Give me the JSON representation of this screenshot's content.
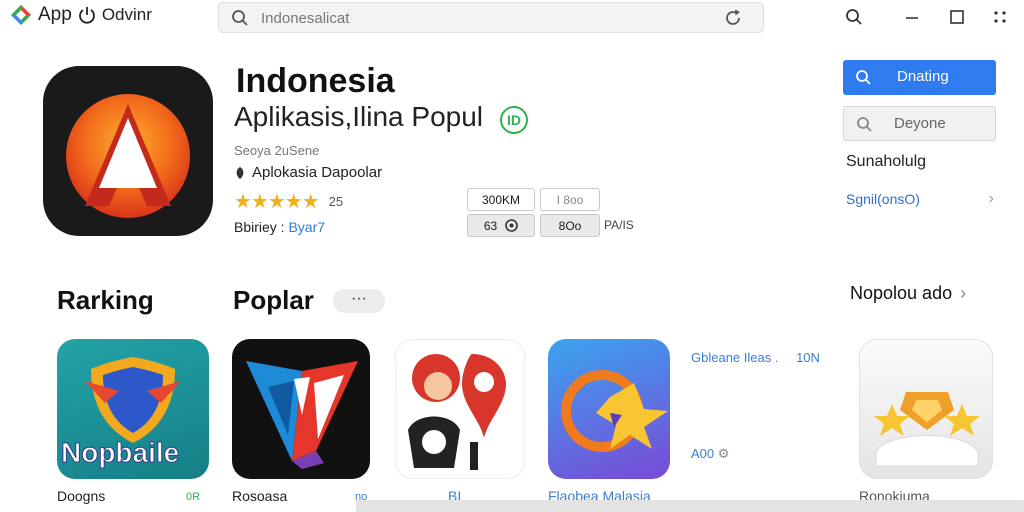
{
  "app": {
    "name": "App",
    "suffix": "Odvinr"
  },
  "search": {
    "placeholder": "Indonesalicat"
  },
  "hero": {
    "title": "Indonesia",
    "subtitle": "Aplikasis,Ilina Popul",
    "badge": "ID",
    "developer": "Seoya 2uSene",
    "tagline": "Aplokasia Dapoolar",
    "rating_value": 5,
    "rating_text": "25",
    "meta_label": "Bbiriey",
    "meta_value": "Byar7",
    "chips": {
      "size": "300KM",
      "version": "I 8oo",
      "count": "63",
      "age": "8Oo",
      "extra": "PA/IS"
    }
  },
  "side": {
    "primary_label": "Dnating",
    "secondary_label": "Deyone",
    "section_label": "Sunaholulg",
    "link_label": "Sgnil(onsO)"
  },
  "sections": {
    "ranking": "Rarking",
    "popular": "Poplar",
    "more": "···",
    "see_all": "Nopolou ado"
  },
  "apps": [
    {
      "name": "Doogns",
      "tag": "0R",
      "tag_color": "#2bb24c",
      "logo_text": "Nopbaile"
    },
    {
      "name": "Rosoasa",
      "tag": "no",
      "tag_color": "#3a7fd0"
    },
    {
      "name": "BI",
      "tag": "",
      "tag_color": "#3a7fd0"
    },
    {
      "name": "Flaobea Malasia",
      "tag": "",
      "tag_color": "#3a7fd0"
    },
    {
      "name": "Ronokiuma",
      "tag": "",
      "tag_color": "#3a7fd0"
    }
  ],
  "promo": {
    "text": "Gbleane Ileas .",
    "count": "10N",
    "meta": "A00"
  },
  "colors": {
    "accent": "#2f7bf0",
    "star": "#f2b01e",
    "link": "#2f7bd6"
  },
  "icons": {
    "logo": "gem-logo-icon",
    "power": "power-icon",
    "search": "search-icon",
    "refresh": "refresh-icon",
    "window_search": "search-icon",
    "minimize": "minimize-icon",
    "maximize": "maximize-icon",
    "menu": "grid-dots-icon"
  }
}
